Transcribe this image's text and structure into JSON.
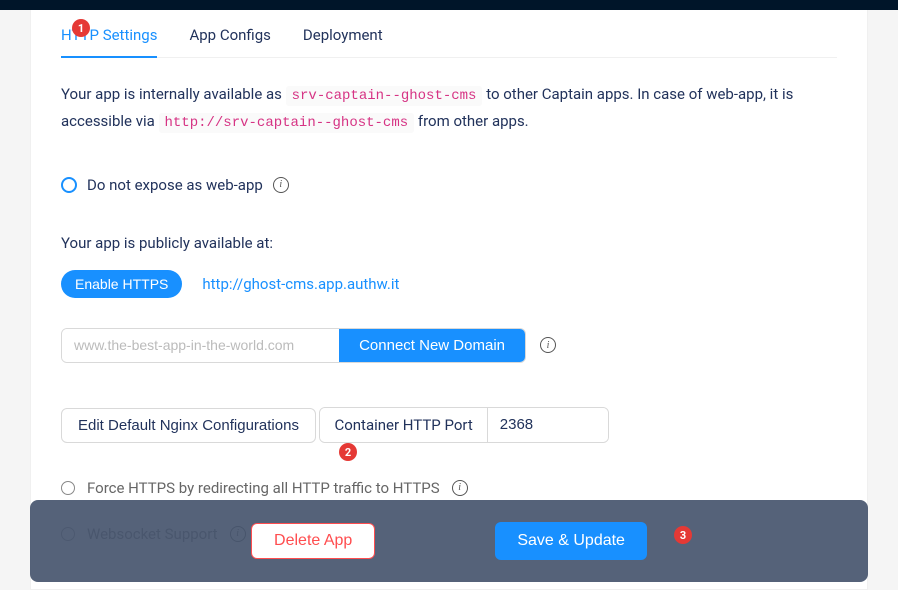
{
  "tabs": {
    "http_settings": "HTTP Settings",
    "app_configs": "App Configs",
    "deployment": "Deployment"
  },
  "description": {
    "part1": "Your app is internally available as ",
    "code1": "srv-captain--ghost-cms",
    "part2": " to other Captain apps. In case of web-app, it is accessible via ",
    "code2": "http://srv-captain--ghost-cms",
    "part3": " from other apps."
  },
  "expose": {
    "label": "Do not expose as web-app"
  },
  "public": {
    "label": "Your app is publicly available at:",
    "enable_https": "Enable HTTPS",
    "url": "http://ghost-cms.app.authw.it"
  },
  "domain": {
    "placeholder": "www.the-best-app-in-the-world.com",
    "connect": "Connect New Domain"
  },
  "nginx": {
    "edit": "Edit Default Nginx Configurations"
  },
  "port": {
    "label": "Container HTTP Port",
    "value": "2368"
  },
  "options": {
    "force_https": "Force HTTPS by redirecting all HTTP traffic to HTTPS",
    "websocket": "Websocket Support"
  },
  "actions": {
    "delete": "Delete App",
    "save": "Save & Update"
  },
  "annotations": {
    "a1": "1",
    "a2": "2",
    "a3": "3"
  }
}
